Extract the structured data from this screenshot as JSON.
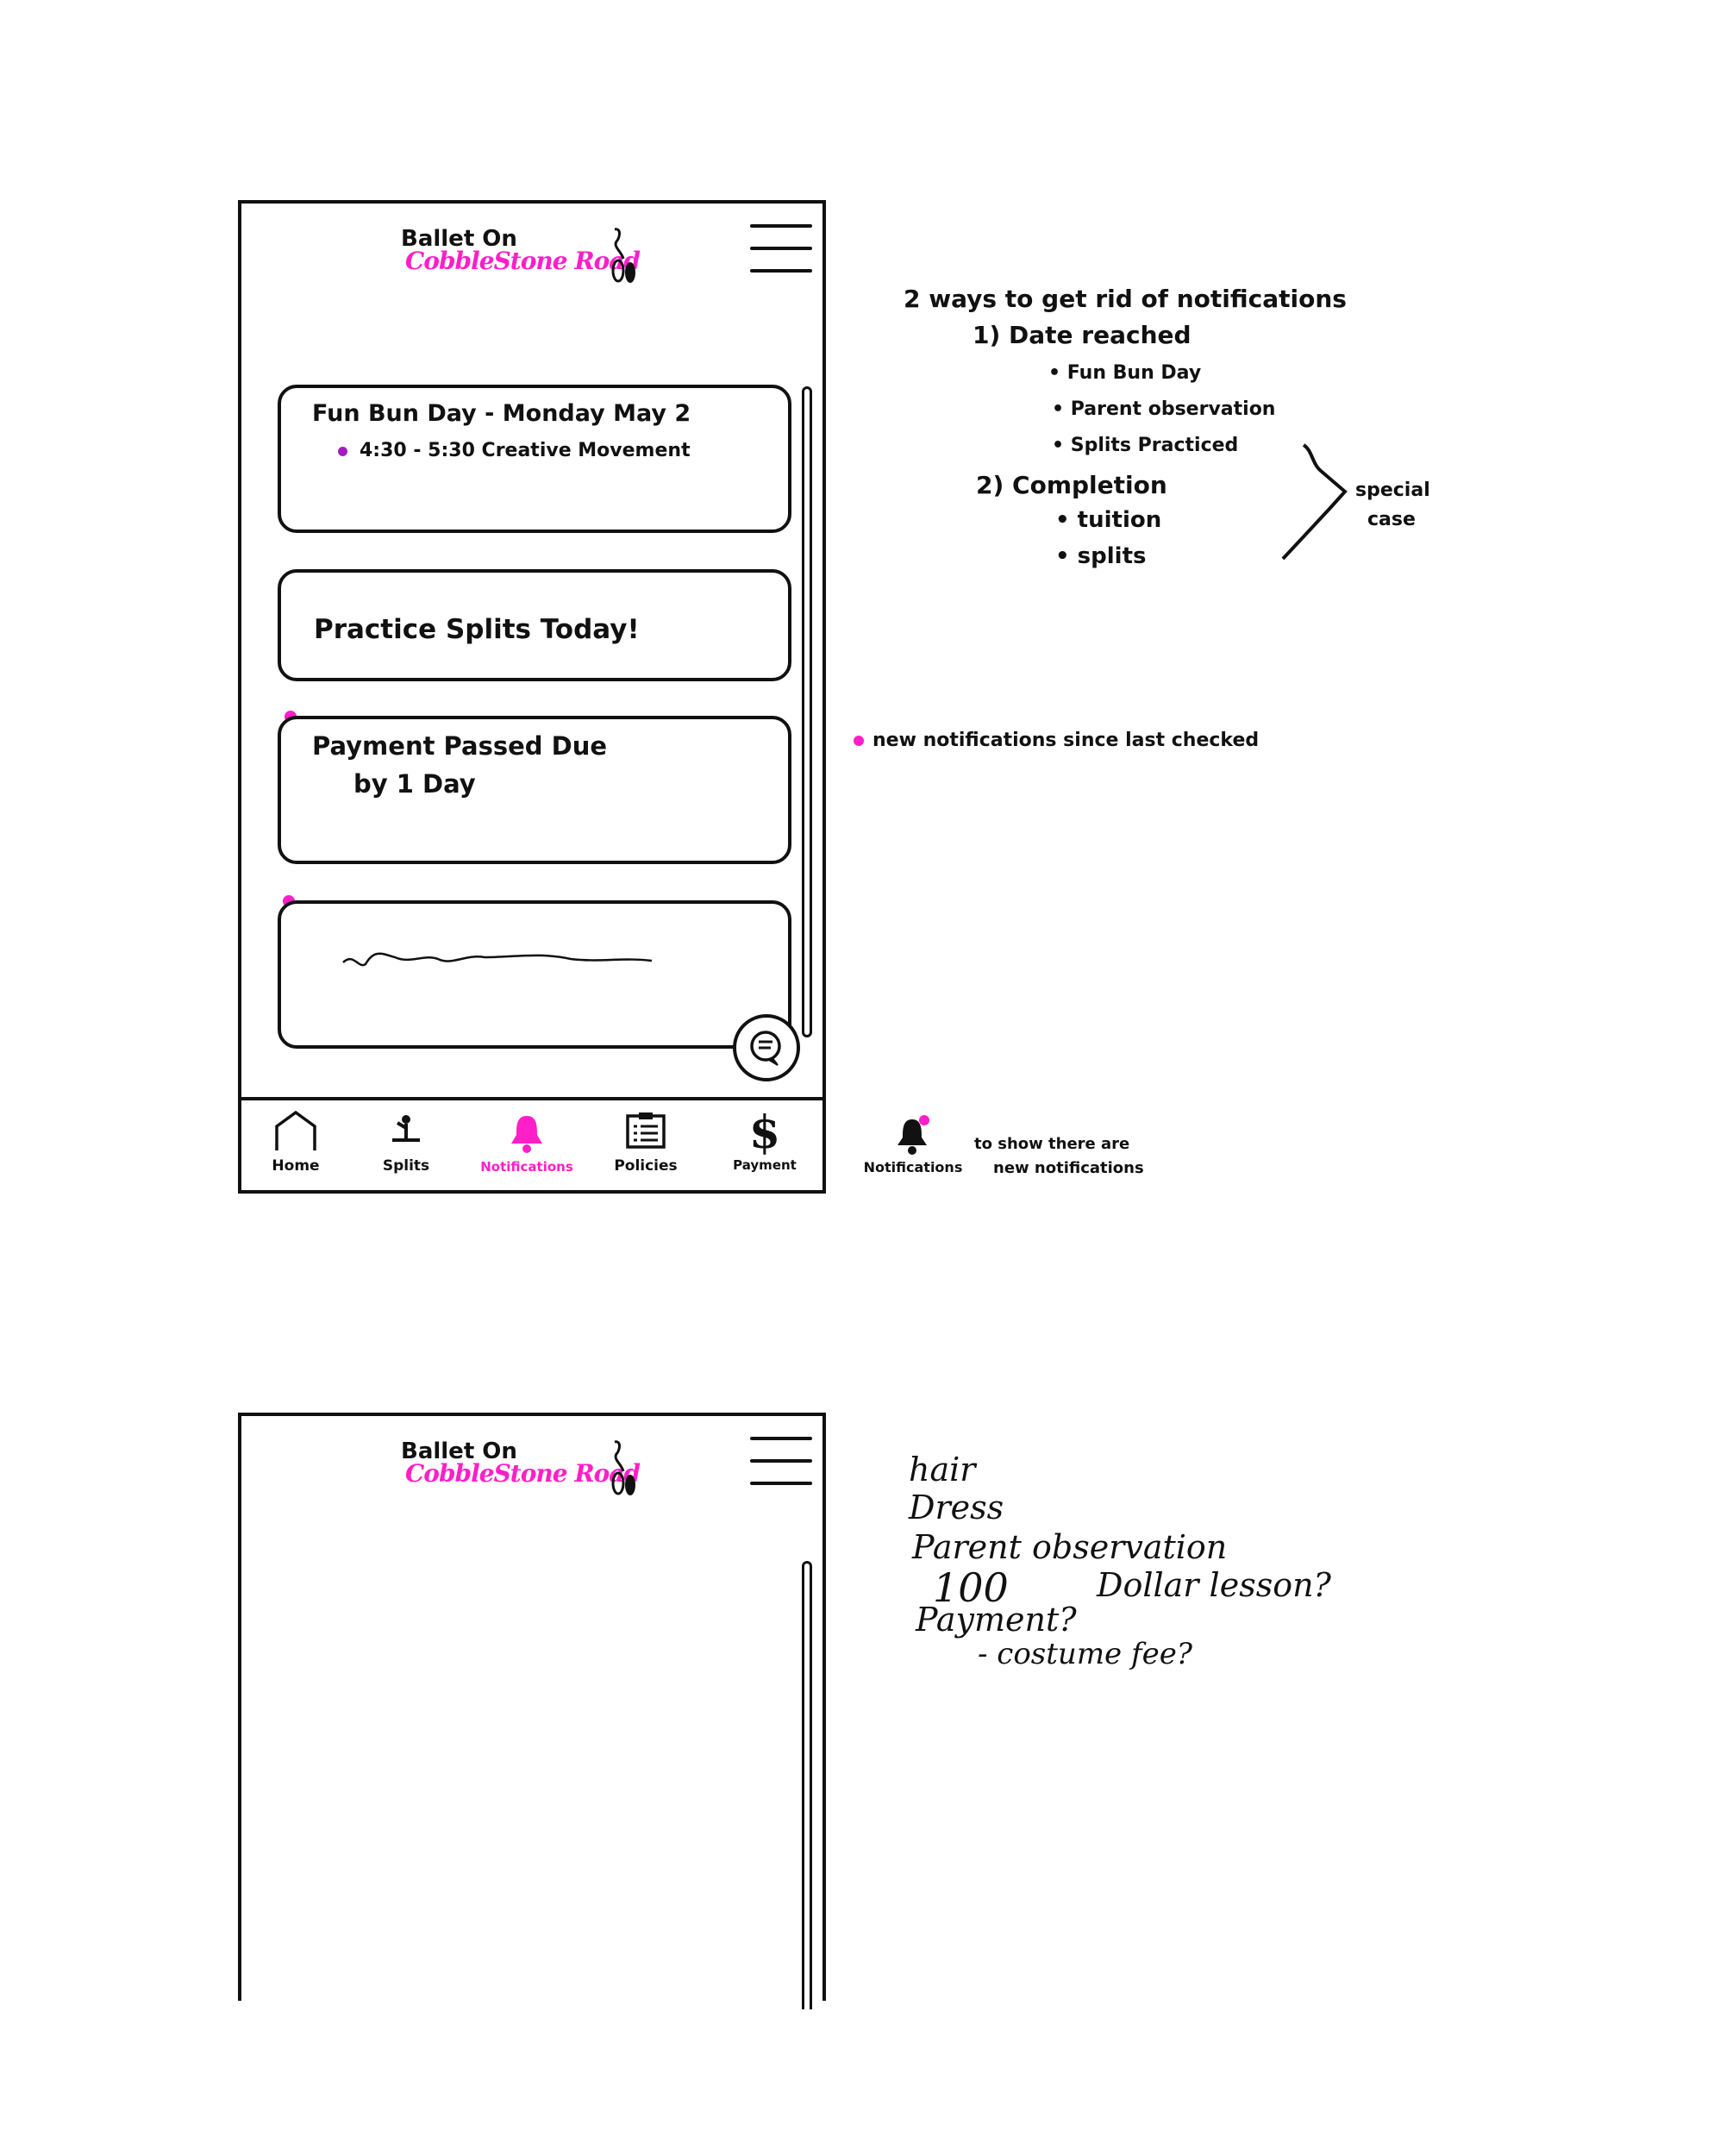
{
  "app": {
    "logo_line1": "Ballet On",
    "logo_line2": "CobbleStone Road"
  },
  "notifications": [
    {
      "title": "Fun Bun Day - Monday May 2",
      "detail": "4:30 - 5:30 Creative Movement"
    },
    {
      "title": "Practice Splits Today!"
    },
    {
      "title_line1": "Payment Passed Due",
      "title_line2": "by 1 Day"
    }
  ],
  "nav": [
    {
      "label": "Home",
      "icon": "home-icon"
    },
    {
      "label": "Splits",
      "icon": "splits-icon"
    },
    {
      "label": "Notifications",
      "icon": "bell-icon",
      "active": true
    },
    {
      "label": "Policies",
      "icon": "clipboard-icon"
    },
    {
      "label": "Payment",
      "icon": "dollar-icon"
    }
  ],
  "annotations": {
    "heading": "2 ways to get rid of notifications",
    "way1": "1) Date reached",
    "way1_items": [
      "Fun Bun Day",
      "Parent observation",
      "Splits Practiced"
    ],
    "way2": "2) Completion",
    "way2_items": [
      "tuition",
      "splits"
    ],
    "special_case": [
      "special",
      "case"
    ],
    "new_dot_note": "new notifications since last checked",
    "bell_label": "Notifications",
    "bell_note": [
      "to show there are",
      "new notifications"
    ]
  },
  "brainstorm": [
    "hair",
    "Dress",
    "Parent observation",
    "100",
    "Dollar lesson?",
    "Payment?",
    "- costume fee?"
  ],
  "colors": {
    "accent": "#ff1fc8",
    "dot": "#a61cc2",
    "ink": "#111111"
  }
}
